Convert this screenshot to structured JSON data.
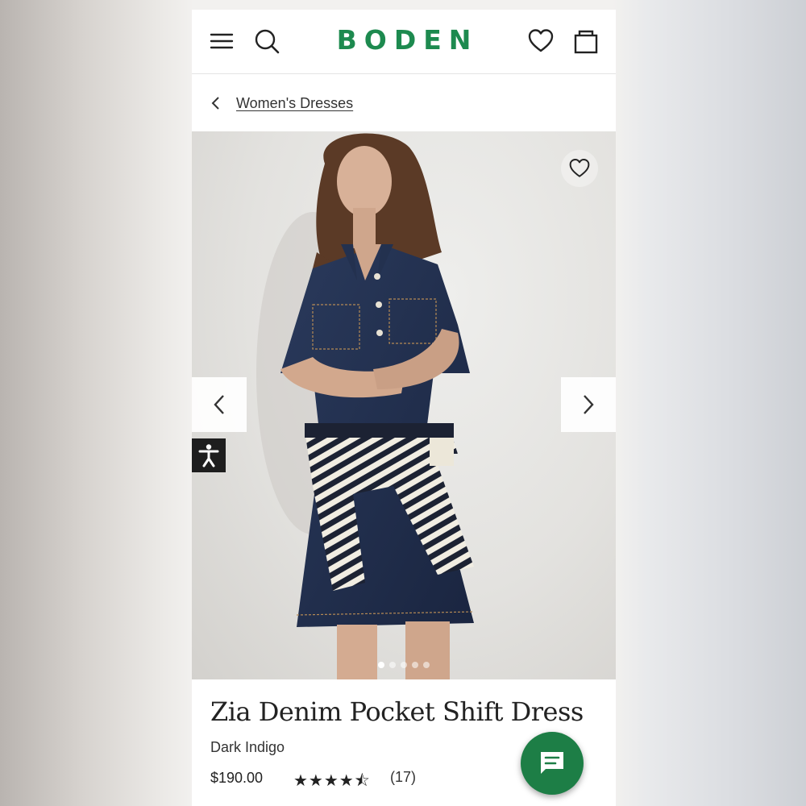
{
  "header": {
    "brand": "BODEN",
    "icons": [
      "menu-icon",
      "search-icon",
      "heart-icon",
      "bag-icon"
    ],
    "brand_color": "#1d8a4f"
  },
  "breadcrumb": {
    "label": "Women's Dresses"
  },
  "gallery": {
    "image_count": 5,
    "active_index": 0
  },
  "product": {
    "name": "Zia Denim Pocket Shift Dress",
    "color": "Dark Indigo",
    "price": "$190.00",
    "rating": 4.5,
    "stars_display": "★★★★⯪",
    "reviews": "(17)"
  },
  "chat": {
    "color": "#1d7e46",
    "icon": "chat-icon"
  }
}
